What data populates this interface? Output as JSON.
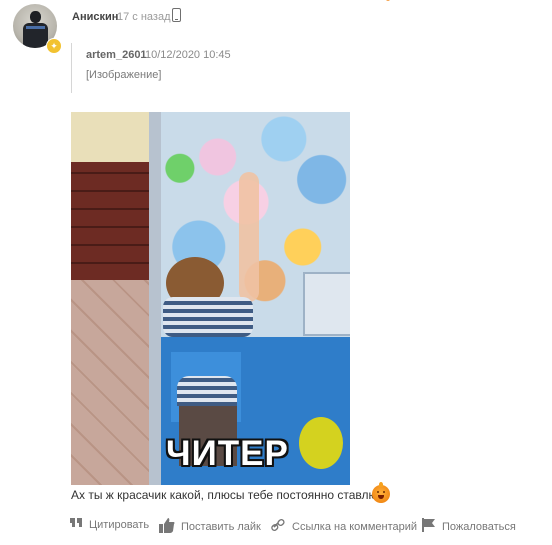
{
  "comment": {
    "author": "Анискин",
    "time": "17 с назад",
    "quote": {
      "author": "artem_2601",
      "date": "10/12/2020 10:45",
      "text": "[Изображение]"
    },
    "image_caption": "ЧИТЕР",
    "text": "Ах ты ж красачик какой, плюсы тебе постоянно ставлю"
  },
  "actions": {
    "quote": "Цитировать",
    "like": "Поставить лайк",
    "link": "Ссылка на комментарий",
    "report": "Пожаловаться"
  },
  "icons": [
    "phone-icon",
    "avatar-badge-icon",
    "quote-icon",
    "like-icon",
    "link-icon",
    "flag-icon",
    "emoji-icon"
  ],
  "colors": {
    "accent": "#f2c230",
    "muted": "#777777"
  }
}
